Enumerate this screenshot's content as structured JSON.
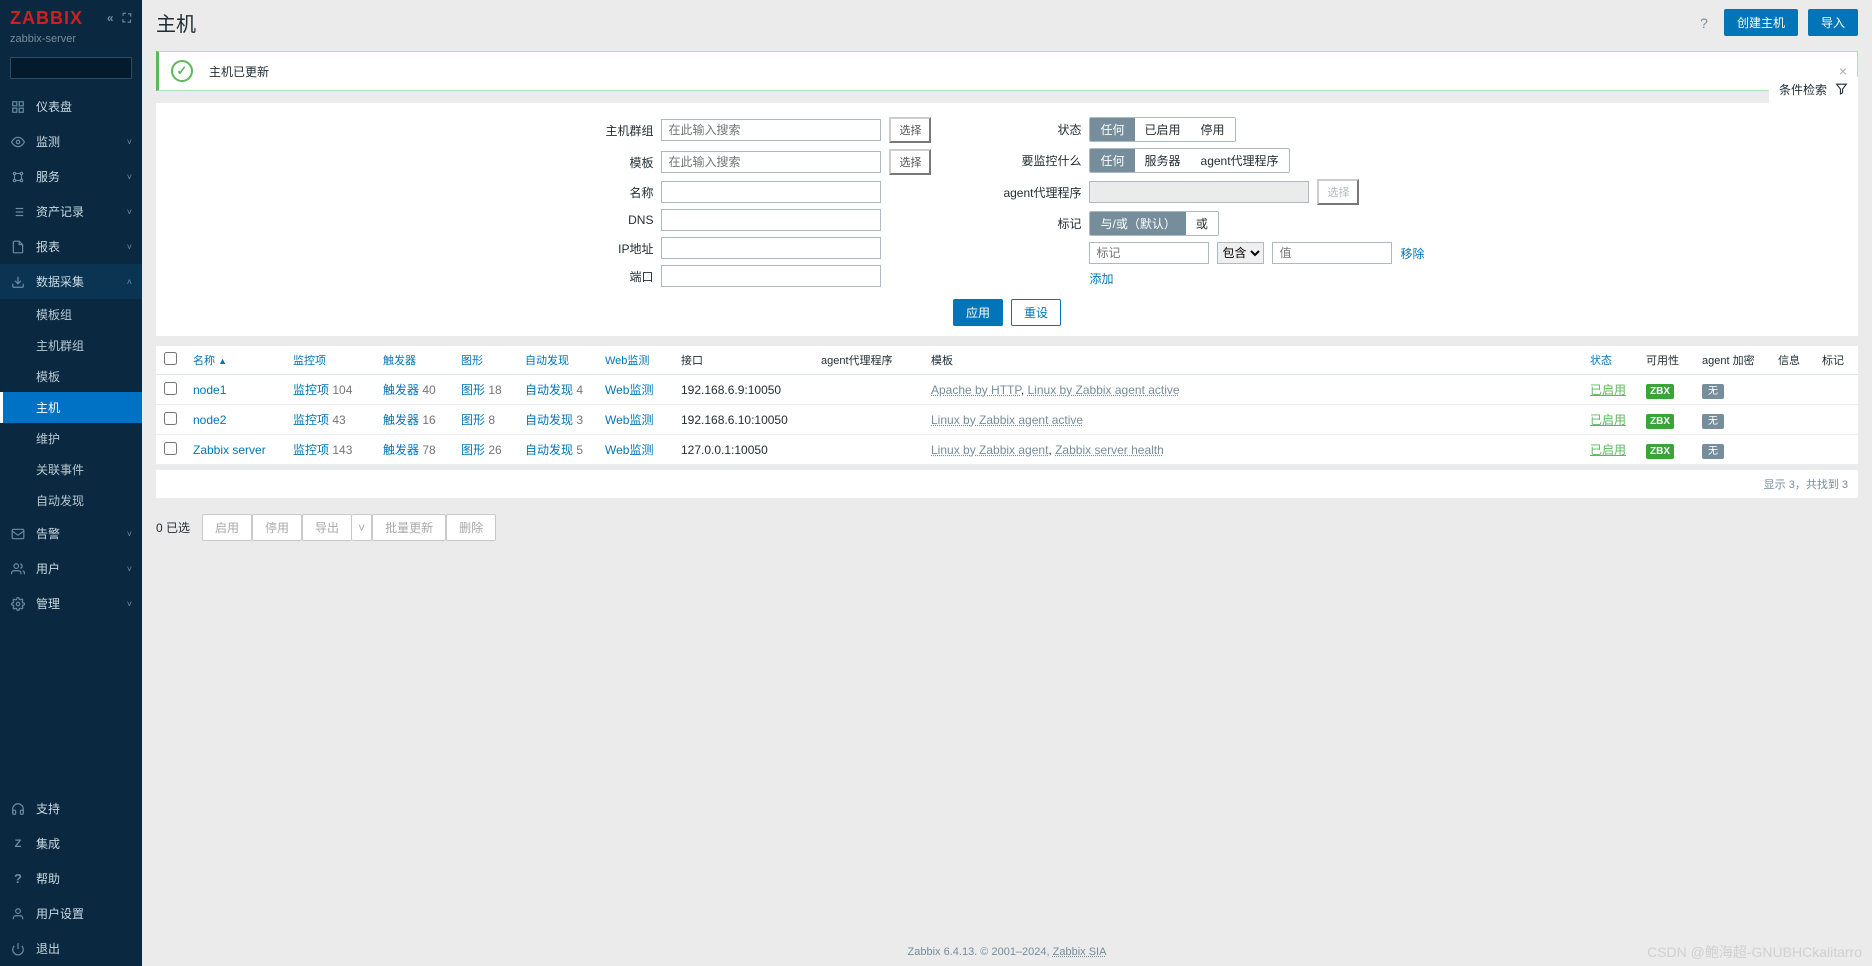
{
  "logo": "ZABBIX",
  "server_name": "zabbix-server",
  "sidebar": {
    "main_items": [
      {
        "icon": "grid",
        "label": "仪表盘",
        "chev": false
      },
      {
        "icon": "eye",
        "label": "监测",
        "chev": true
      },
      {
        "icon": "tree",
        "label": "服务",
        "chev": true
      },
      {
        "icon": "list",
        "label": "资产记录",
        "chev": true
      },
      {
        "icon": "doc",
        "label": "报表",
        "chev": true
      },
      {
        "icon": "download",
        "label": "数据采集",
        "chev": true,
        "open": true
      }
    ],
    "sub_items": [
      "模板组",
      "主机群组",
      "模板",
      "主机",
      "维护",
      "关联事件",
      "自动发现"
    ],
    "active_sub": "主机",
    "post_items": [
      {
        "icon": "mail",
        "label": "告警",
        "chev": true
      },
      {
        "icon": "users",
        "label": "用户",
        "chev": true
      },
      {
        "icon": "gear",
        "label": "管理",
        "chev": true
      }
    ],
    "bottom_items": [
      {
        "icon": "headset",
        "label": "支持"
      },
      {
        "icon": "z",
        "label": "集成"
      },
      {
        "icon": "help",
        "label": "帮助"
      },
      {
        "icon": "user",
        "label": "用户设置"
      },
      {
        "icon": "power",
        "label": "退出"
      }
    ]
  },
  "page": {
    "title": "主机",
    "btn_create": "创建主机",
    "btn_import": "导入"
  },
  "alert": {
    "message": "主机已更新"
  },
  "filter": {
    "tab_label": "条件检索",
    "labels": {
      "hostgroup": "主机群组",
      "template": "模板",
      "name": "名称",
      "dns": "DNS",
      "ip": "IP地址",
      "port": "端口",
      "status": "状态",
      "monitor": "要监控什么",
      "proxy": "agent代理程序",
      "tags": "标记"
    },
    "search_placeholder": "在此输入搜索",
    "select_btn": "选择",
    "status_opts": [
      "任何",
      "已启用",
      "停用"
    ],
    "monitor_opts": [
      "任何",
      "服务器",
      "agent代理程序"
    ],
    "tag_logic_opts": [
      "与/或（默认）",
      "或"
    ],
    "tag_placeholder_key": "标记",
    "tag_op": "包含",
    "tag_placeholder_val": "值",
    "remove": "移除",
    "add": "添加",
    "apply": "应用",
    "reset": "重设"
  },
  "table": {
    "headers": {
      "name": "名称",
      "items": "监控项",
      "triggers": "触发器",
      "graphs": "图形",
      "discovery": "自动发现",
      "web": "Web监测",
      "interface": "接口",
      "proxy": "agent代理程序",
      "templates": "模板",
      "status": "状态",
      "availability": "可用性",
      "encryption": "agent 加密",
      "info": "信息",
      "tags": "标记"
    },
    "rows": [
      {
        "name": "node1",
        "items": "104",
        "triggers": "40",
        "graphs": "18",
        "discovery": "4",
        "interface": "192.168.6.9:10050",
        "templates": [
          "Apache by HTTP",
          "Linux by Zabbix agent active"
        ],
        "status": "已启用",
        "av": "ZBX",
        "enc": "无"
      },
      {
        "name": "node2",
        "items": "43",
        "triggers": "16",
        "graphs": "8",
        "discovery": "3",
        "interface": "192.168.6.10:10050",
        "templates": [
          "Linux by Zabbix agent active"
        ],
        "status": "已启用",
        "av": "ZBX",
        "enc": "无"
      },
      {
        "name": "Zabbix server",
        "items": "143",
        "triggers": "78",
        "graphs": "26",
        "discovery": "5",
        "interface": "127.0.0.1:10050",
        "templates": [
          "Linux by Zabbix agent",
          "Zabbix server health"
        ],
        "status": "已启用",
        "av": "ZBX",
        "enc": "无"
      }
    ],
    "item_link": "监控项",
    "trigger_link": "触发器",
    "graph_link": "图形",
    "discovery_link": "自动发现",
    "web_link": "Web监测",
    "footer": "显示 3，共找到 3"
  },
  "bulk": {
    "selected": "0 已选",
    "buttons": [
      "启用",
      "停用",
      "导出",
      "批量更新",
      "删除"
    ]
  },
  "footer": {
    "text": "Zabbix 6.4.13. © 2001–2024, ",
    "link": "Zabbix SIA"
  },
  "watermark": "CSDN @鲍海超-GNUBHCkalitarro"
}
